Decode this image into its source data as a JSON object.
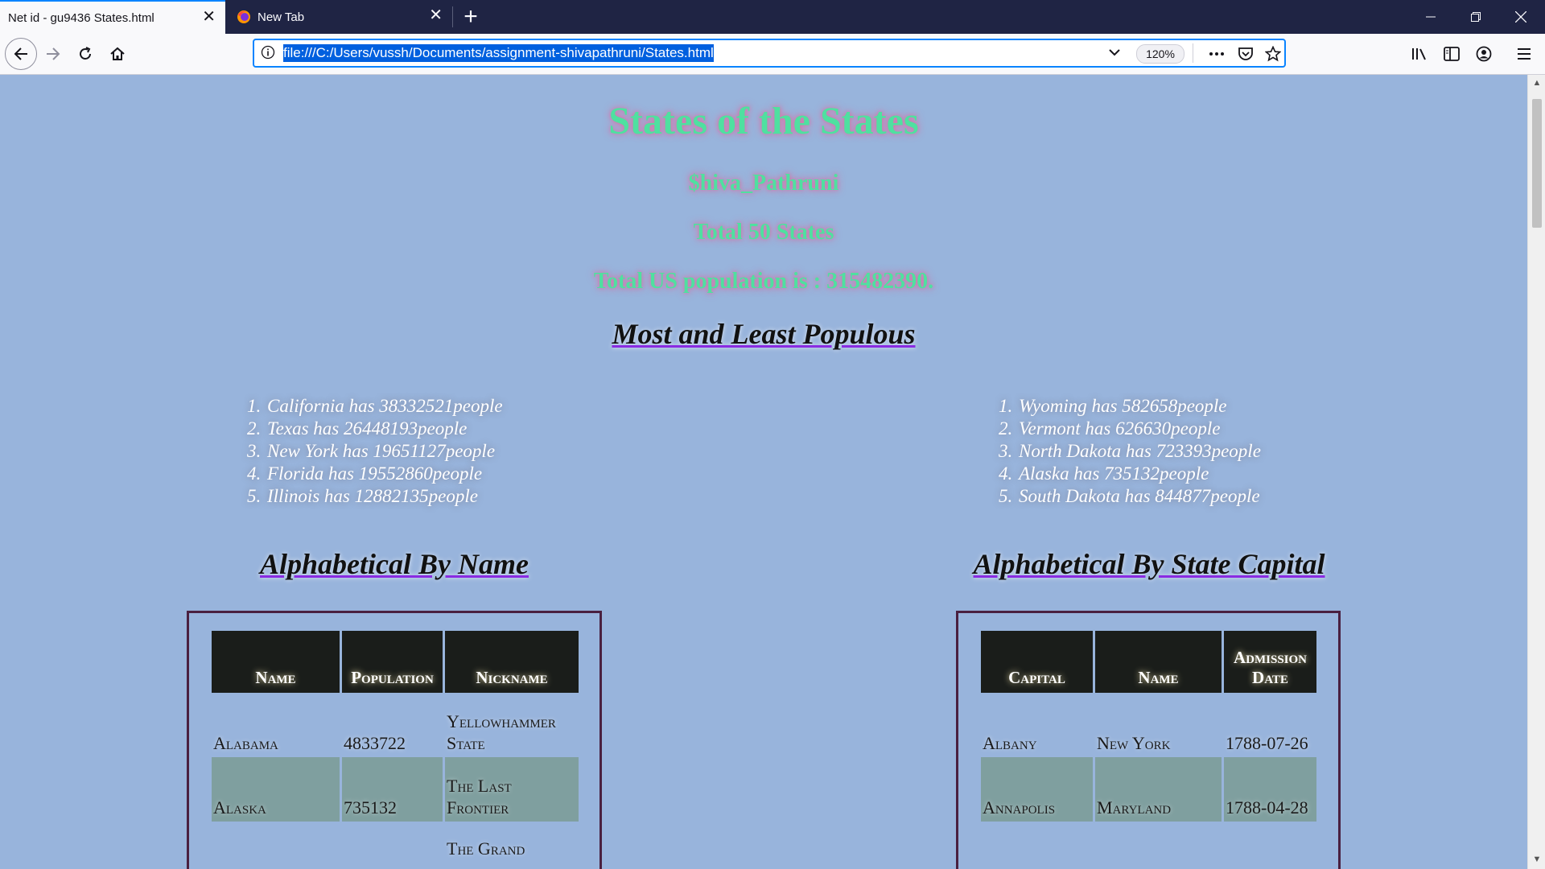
{
  "browser": {
    "active_tab_title": "Net id - gu9436 States.html",
    "inactive_tab_title": "New Tab",
    "url": "file:///C:/Users/vussh/Documents/assignment-shivapathruni/States.html",
    "zoom": "120%"
  },
  "page": {
    "title": "States of the States",
    "author": "$hiva_Pathruni",
    "total_states": "Total 50 States",
    "total_population": "Total US population is : 315482390.",
    "most_least_heading": "Most and Least Populous",
    "most_populous": [
      "California has 38332521people",
      "Texas has 26448193people",
      "New York has 19651127people",
      "Florida has 19552860people",
      "Illinois has 12882135people"
    ],
    "least_populous": [
      "Wyoming has 582658people",
      "Vermont has 626630people",
      "North Dakota has 723393people",
      "Alaska has 735132people",
      "South Dakota has 844877people"
    ],
    "by_name_heading": "Alphabetical By Name",
    "by_capital_heading": "Alphabetical By State Capital",
    "by_name_table": {
      "headers": [
        "Name",
        "Population",
        "Nickname"
      ],
      "rows": [
        [
          "Alabama",
          "4833722",
          "Yellowhammer State"
        ],
        [
          "Alaska",
          "735132",
          "The Last Frontier"
        ],
        [
          "",
          "",
          "The Grand"
        ]
      ]
    },
    "by_capital_table": {
      "headers": [
        "Capital",
        "Name",
        "Admission Date"
      ],
      "rows": [
        [
          "Albany",
          "New York",
          "1788-07-26"
        ],
        [
          "Annapolis",
          "Maryland",
          "1788-04-28"
        ]
      ]
    }
  },
  "colors": {
    "page_bg": "#98b4dc",
    "title_green": "#4fe0a0",
    "heading_underline": "#8a2be2",
    "table_header_bg": "#1a1d1a",
    "alt_row_bg": "#7f9f9f"
  }
}
